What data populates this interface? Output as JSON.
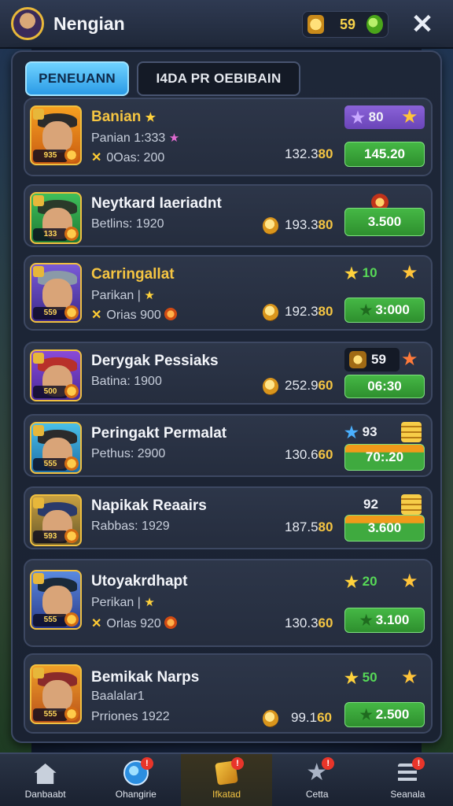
{
  "header": {
    "title": "Nengian",
    "coin_value": "59",
    "close_label": "✕"
  },
  "tabs": [
    {
      "label": "PENEUANN",
      "active": true
    },
    {
      "label": "I4DA PR OEBIBAIN",
      "active": false
    }
  ],
  "players": [
    {
      "name": "Banian",
      "name_star": "★",
      "line2": "Panian 1:333",
      "line3": "0Oas: 200",
      "score_main": "132.3",
      "score_tail": "80",
      "rating": "80",
      "price": "145.20"
    },
    {
      "name": "Neytkard Iaeriadnt",
      "line2": "Betlins: 1920",
      "line3": "",
      "score_main": "193.3",
      "score_tail": "80",
      "rating": "",
      "price": "3.500"
    },
    {
      "name": "Carringallat",
      "line2": "Parikan |",
      "line3": "Orias 900",
      "score_main": "192.3",
      "score_tail": "80",
      "rating": "10",
      "price": "3:000"
    },
    {
      "name": "Derygak Pessiaks",
      "line2": "Batina: 1900",
      "line3": "",
      "score_main": "252.9",
      "score_tail": "60",
      "rating": "59",
      "price": "06:30"
    },
    {
      "name": "Peringakt Permalat",
      "line2": "Pethus: 2900",
      "line3": "",
      "score_main": "130.6",
      "score_tail": "60",
      "rating": "93",
      "price": "70:.20"
    },
    {
      "name": "Napikak Reaairs",
      "line2": "Rabbas: 1929",
      "line3": "",
      "score_main": "187.5",
      "score_tail": "80",
      "rating": "92",
      "price": "3.600"
    },
    {
      "name": "Utoyakrdhapt",
      "line2": "Perikan |",
      "line3": "Orlas 920",
      "score_main": "130.3",
      "score_tail": "60",
      "rating": "20",
      "price": "3.100"
    },
    {
      "name": "Bemikak Narps",
      "line2": "Baalalar1",
      "line3": "Prriones 1922",
      "score_main": "99.1",
      "score_tail": "60",
      "rating": "50",
      "price": "2.500"
    }
  ],
  "thumb_levels": [
    "935",
    "133",
    "559",
    "500",
    "555",
    "593",
    "555",
    "555"
  ],
  "nav": [
    {
      "label": "Danbaabt",
      "icon": "home-icon",
      "notif": ""
    },
    {
      "label": "Ohangirie",
      "icon": "globe-icon",
      "notif": "!"
    },
    {
      "label": "Ifkatad",
      "icon": "cards-icon",
      "notif": "!"
    },
    {
      "label": "Cetta",
      "icon": "star-icon",
      "notif": "!"
    },
    {
      "label": "Seanala",
      "icon": "menu-icon",
      "notif": "!"
    }
  ],
  "colors": {
    "accent_gold": "#f5c542",
    "button_green": "#3faa3f",
    "tab_blue": "#2b9be6",
    "panel_bg": "#1e2738"
  }
}
